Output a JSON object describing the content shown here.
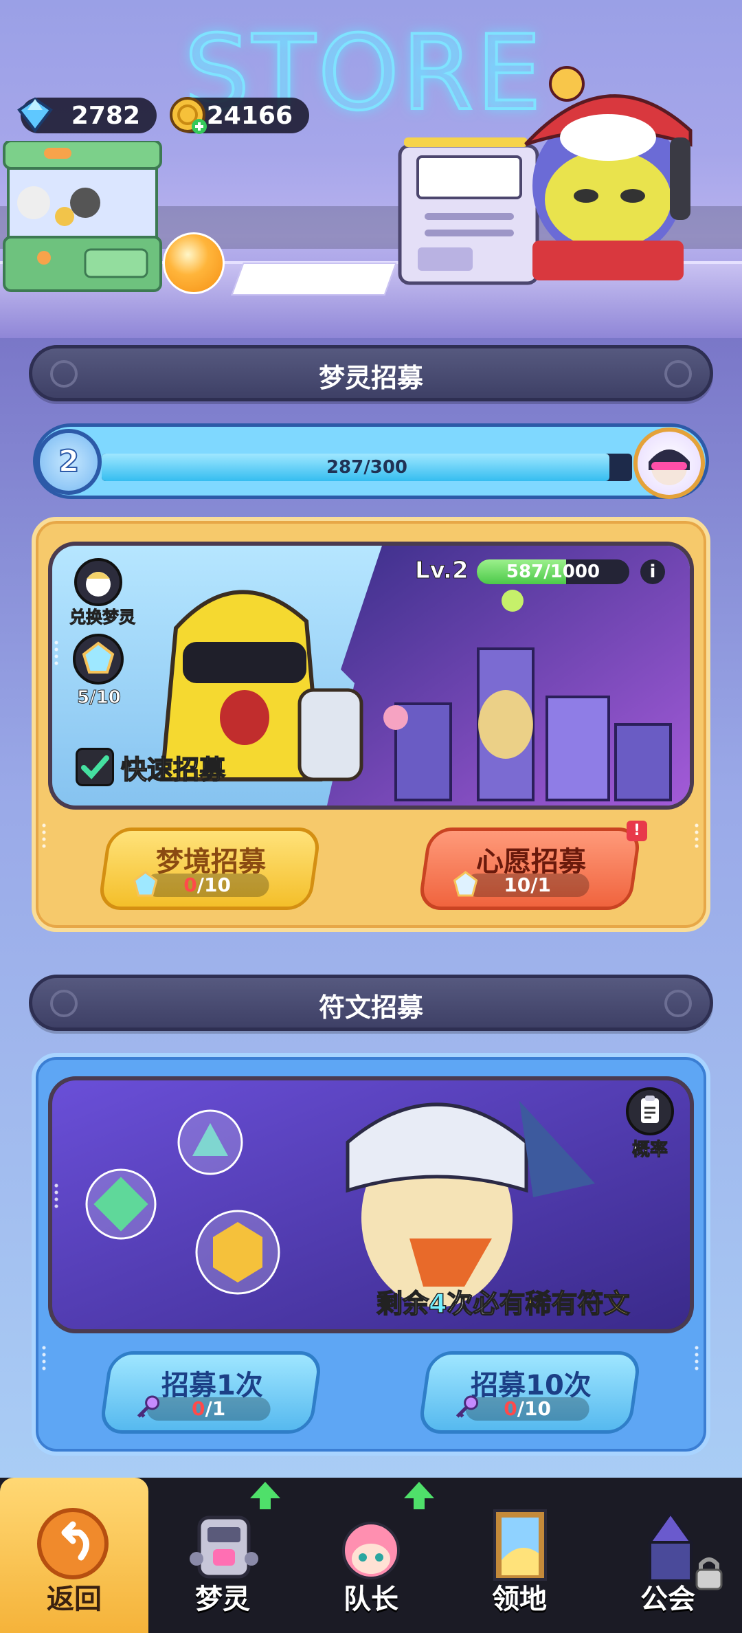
{
  "store_sign": "STORE",
  "currency": {
    "diamonds": "2782",
    "coins": "24166"
  },
  "dream_section": {
    "title": "梦灵招募",
    "level": "2",
    "progress_text": "287/300",
    "progress": 0.957,
    "banner": {
      "exchange_label": "兑换梦灵",
      "crystal_count": "5/10",
      "quick_recruit_label": "快速招募",
      "quick_recruit_checked": true,
      "pool_level": "Lv.2",
      "pool_xp_text": "587/1000",
      "pool_xp_progress": 0.587
    },
    "buttons": [
      {
        "label": "梦境招募",
        "cost_have": "0",
        "cost_need": "/10"
      },
      {
        "label": "心愿招募",
        "cost_text": "10/1",
        "badge": "!"
      }
    ]
  },
  "rune_section": {
    "title": "符文招募",
    "odds_label": "概率",
    "guarantee_prefix": "剩余",
    "guarantee_count": "4",
    "guarantee_mid": "次必有",
    "guarantee_item": "稀有符文",
    "buttons": [
      {
        "label": "招募1次",
        "cost_have": "0",
        "cost_need": "/1"
      },
      {
        "label": "招募10次",
        "cost_have": "0",
        "cost_need": "/10"
      }
    ]
  },
  "nav": [
    {
      "label": "返回",
      "active": true
    },
    {
      "label": "梦灵",
      "upgrade": true
    },
    {
      "label": "队长",
      "upgrade": true
    },
    {
      "label": "领地"
    },
    {
      "label": "公会",
      "locked": true
    }
  ],
  "colors": {
    "accent_yellow": "#f6c96b",
    "accent_blue": "#5ea6f4",
    "progress_fill": "#35bdf0",
    "xp_green": "#5fd35a"
  }
}
